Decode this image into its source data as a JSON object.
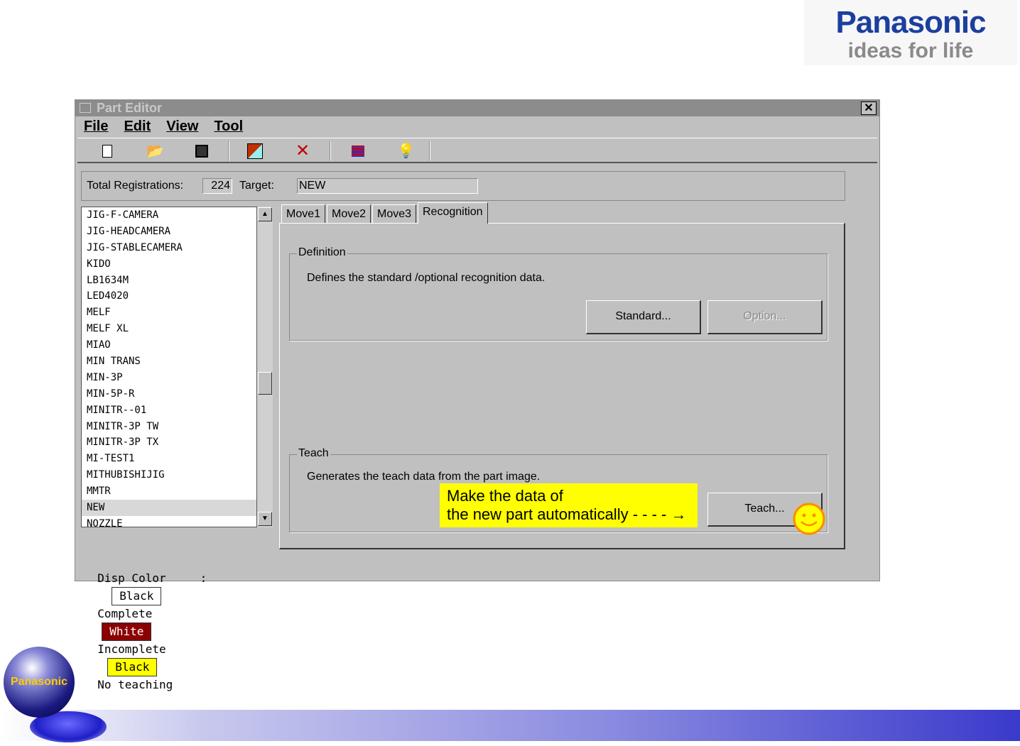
{
  "brand": {
    "name": "Panasonic",
    "tagline": "ideas for life",
    "sphere_label": "Panasonic"
  },
  "window": {
    "title": "Part Editor",
    "close": "✕"
  },
  "menu": [
    "File",
    "Edit",
    "View",
    "Tool"
  ],
  "info": {
    "total_label": "Total Registrations:",
    "total_value": "224",
    "target_label": "Target:",
    "target_value": "NEW"
  },
  "parts": [
    "JIG-F-CAMERA",
    "JIG-HEADCAMERA",
    "JIG-STABLECAMERA",
    "KIDO",
    "LB1634M",
    "LED4020",
    "MELF",
    "MELF XL",
    "MIAO",
    "MIN TRANS",
    "MIN-3P",
    "MIN-5P-R",
    "MINITR--01",
    "MINITR-3P TW",
    "MINITR-3P TX",
    "MI-TEST1",
    "MITHUBISHIJIG",
    "MMTR",
    "NEW",
    "NOZZLE"
  ],
  "selected_part": "NEW",
  "tabs": [
    "Move1",
    "Move2",
    "Move3",
    "Recognition"
  ],
  "definition": {
    "title": "Definition",
    "desc": "Defines the standard /optional recognition data.",
    "standard": "Standard...",
    "option": "Option..."
  },
  "teach": {
    "title": "Teach",
    "desc": "Generates the teach data from the part image.",
    "button": "Teach..."
  },
  "callout": {
    "line1": "Make the data of",
    "line2": "the new part automatically - - - - →"
  },
  "footer": {
    "label": "Disp Color",
    "colon": ":",
    "c1": "Black",
    "t1": "Complete",
    "c2": "White",
    "t2": "Incomplete",
    "c3": "Black",
    "t3": "No teaching"
  },
  "colors": {
    "incomplete": "#8b0000",
    "no_teaching": "#ffff00",
    "brand": "#1c3f9e"
  }
}
